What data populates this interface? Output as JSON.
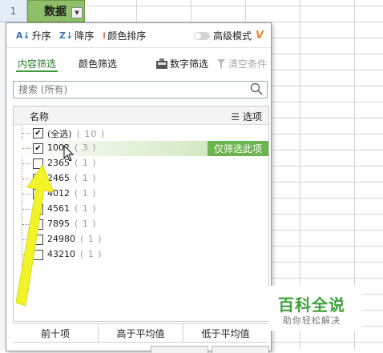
{
  "sheet": {
    "row_number": "1",
    "header_cell": "数据"
  },
  "panel": {
    "toolbar": {
      "sort_asc": "升序",
      "sort_desc": "降序",
      "color_sort": "颜色排序",
      "advanced_mode": "高级模式",
      "vip_badge": "V",
      "sort_asc_icon": "sort-ascending-icon",
      "sort_desc_icon": "sort-descending-icon",
      "color_sort_icon": "color-sort-icon"
    },
    "tabs": {
      "content_filter": "内容筛选",
      "color_filter": "颜色筛选",
      "number_filter": "数字筛选",
      "clear_condition": "清空条件"
    },
    "search": {
      "placeholder": "搜索 (所有)"
    },
    "list": {
      "name_header": "名称",
      "options_label": "选项",
      "only_filter_button": "仅筛选此项",
      "items": [
        {
          "label": "(全选)",
          "count": "( 10 )",
          "checked": "✔"
        },
        {
          "label": "1002",
          "count": "( 3 )",
          "checked": "✔"
        },
        {
          "label": "2365",
          "count": "( 1 )",
          "checked": ""
        },
        {
          "label": "2465",
          "count": "( 1 )",
          "checked": ""
        },
        {
          "label": "4012",
          "count": "( 1 )",
          "checked": ""
        },
        {
          "label": "4561",
          "count": "( 1 )",
          "checked": ""
        },
        {
          "label": "7895",
          "count": "( 1 )",
          "checked": ""
        },
        {
          "label": "24980",
          "count": "( 1 )",
          "checked": ""
        },
        {
          "label": "43210",
          "count": "( 1 )",
          "checked": ""
        }
      ]
    },
    "bottom_buttons": {
      "top_ten": "前十项",
      "above_avg": "高于平均值",
      "below_avg": "低于平均值"
    }
  },
  "watermark": {
    "title": "百科全说",
    "subtitle": "助你轻松解决"
  },
  "colors": {
    "accent_green": "#6bb44e",
    "header_green": "#8fbf68",
    "arrow_yellow": "#f3f32a"
  }
}
